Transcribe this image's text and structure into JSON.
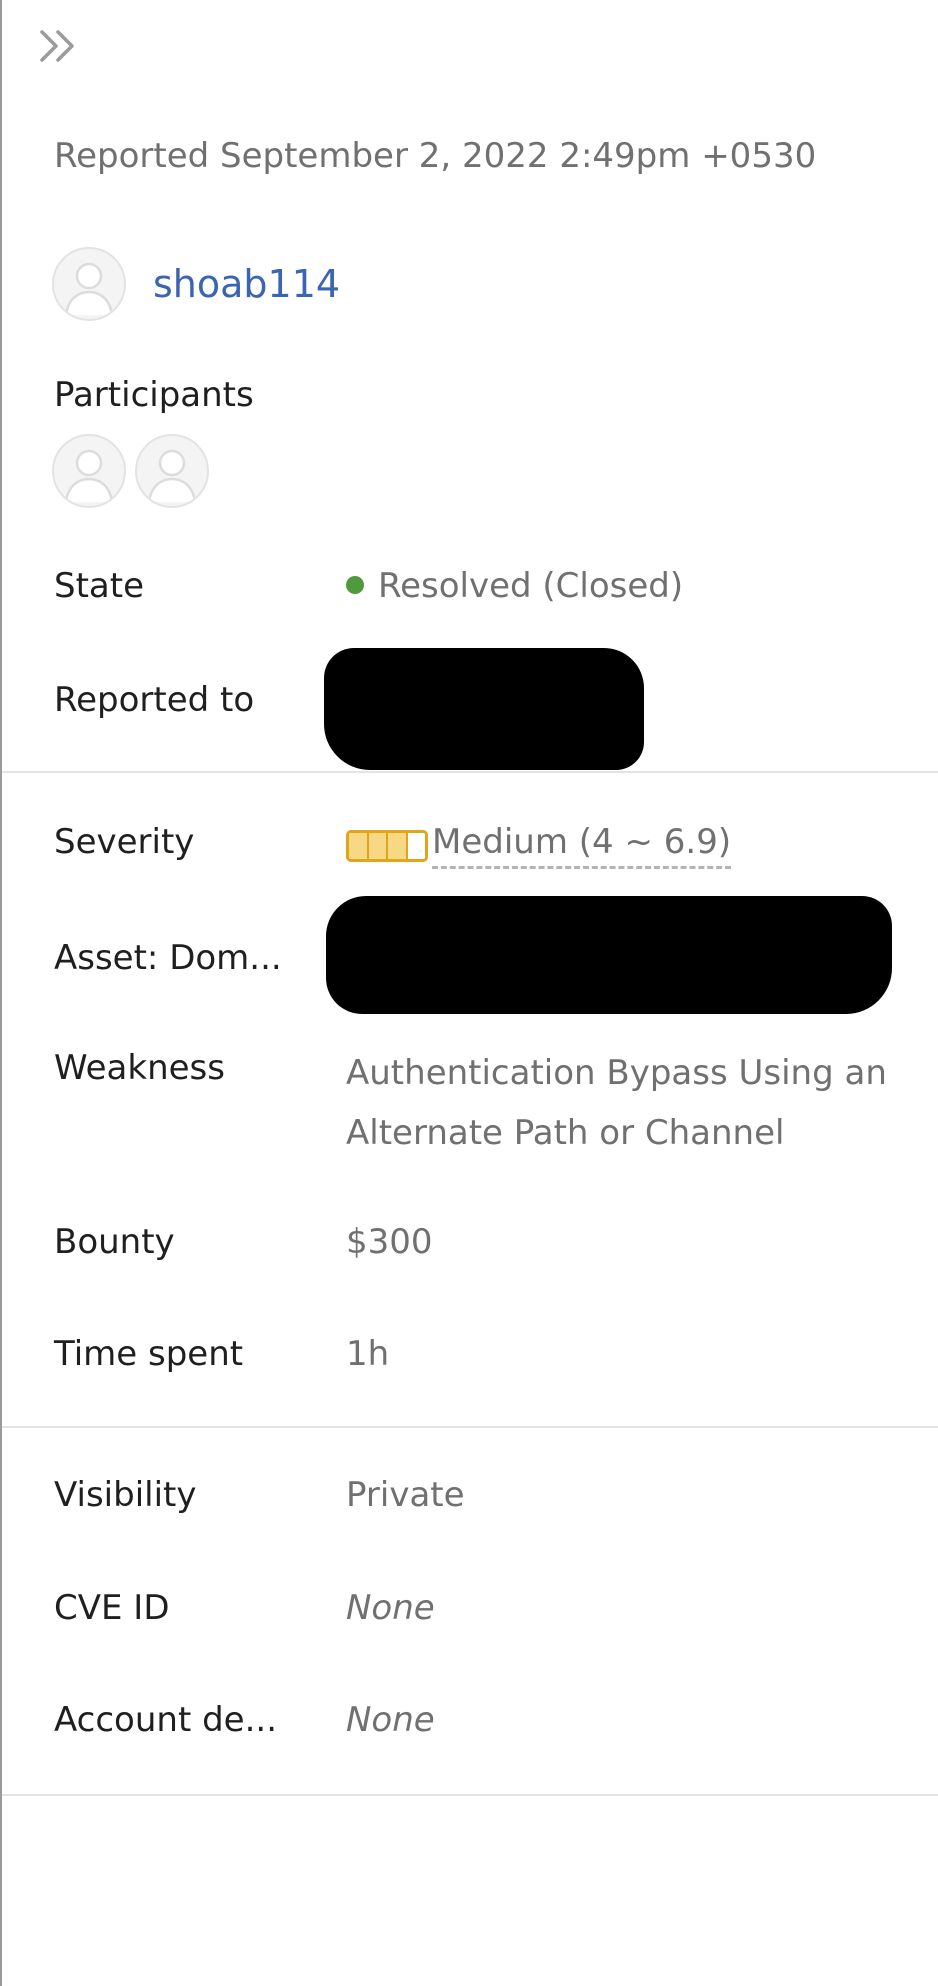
{
  "header": {
    "collapse_icon": "double-chevron-right-icon",
    "reported_time": "Reported September 2, 2022 2:49pm +0530"
  },
  "reporter": {
    "avatar_icon": "user-avatar-icon",
    "username": "shoab114"
  },
  "participants": {
    "label": "Participants",
    "avatar_count": 2
  },
  "details": {
    "state": {
      "label": "State",
      "value": "Resolved (Closed)",
      "status_color": "#4f9a3f"
    },
    "reported_to": {
      "label": "Reported to"
    },
    "severity": {
      "label": "Severity",
      "value": "Medium (4 ~ 6.9)",
      "filled_segments": 3,
      "total_segments": 4
    },
    "asset": {
      "label": "Asset: Dom..."
    },
    "weakness": {
      "label": "Weakness",
      "value": "Authentication Bypass Using an Alternate Path or Channel"
    },
    "bounty": {
      "label": "Bounty",
      "value": "$300"
    },
    "time_spent": {
      "label": "Time spent",
      "value": "1h"
    },
    "visibility": {
      "label": "Visibility",
      "value": "Private"
    },
    "cve_id": {
      "label": "CVE ID",
      "value": "None"
    },
    "account_details": {
      "label": "Account de...",
      "value": "None"
    }
  },
  "colors": {
    "link": "#3b65b3",
    "muted_text": "#707070",
    "severity_medium": "#e0a51a"
  }
}
